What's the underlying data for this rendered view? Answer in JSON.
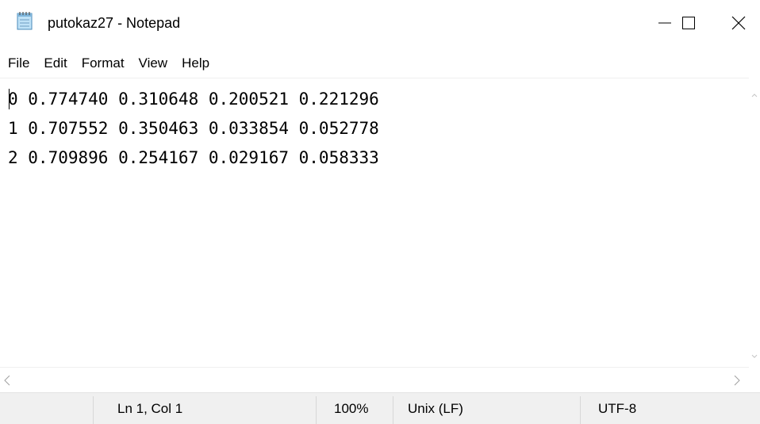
{
  "window": {
    "title": "putokaz27 - Notepad",
    "icon": "notepad-icon"
  },
  "window_controls": {
    "minimize": "minimize-icon",
    "maximize": "maximize-icon",
    "close": "close-icon"
  },
  "menu": {
    "items": [
      "File",
      "Edit",
      "Format",
      "View",
      "Help"
    ]
  },
  "editor": {
    "lines": [
      "0 0.774740 0.310648 0.200521 0.221296",
      "1 0.707552 0.350463 0.033854 0.052778",
      "2 0.709896 0.254167 0.029167 0.058333"
    ]
  },
  "statusbar": {
    "position": "Ln 1, Col 1",
    "zoom": "100%",
    "line_ending": "Unix (LF)",
    "encoding": "UTF-8"
  },
  "colors": {
    "background": "#ffffff",
    "statusbar_bg": "#f0f0f0",
    "scroll_arrow": "#a0a0a0"
  }
}
